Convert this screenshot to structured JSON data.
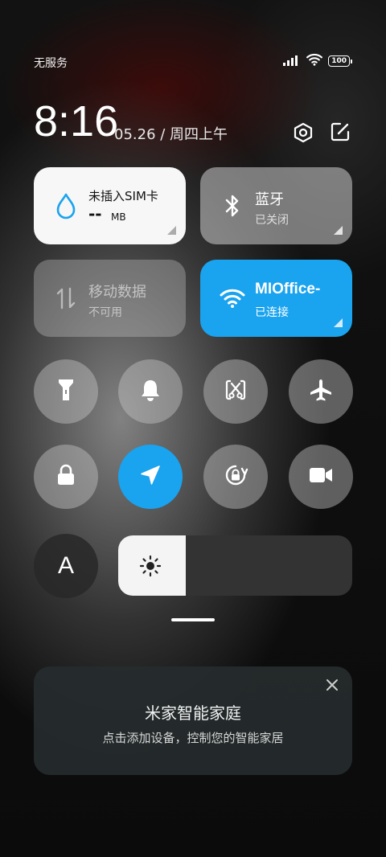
{
  "status_bar": {
    "carrier": "无服务",
    "battery": "100",
    "icons": [
      "signal-icon",
      "wifi-icon",
      "battery-icon"
    ]
  },
  "header": {
    "time": "8:16",
    "date": "05.26 / 周四上午",
    "icons": [
      "settings-icon",
      "edit-icon"
    ]
  },
  "tiles": {
    "sim": {
      "title": "未插入SIM卡",
      "value": "--",
      "unit": "MB",
      "icon": "water-drop-icon"
    },
    "bluetooth": {
      "title": "蓝牙",
      "status": "已关闭",
      "icon": "bluetooth-icon"
    },
    "mobile_data": {
      "title": "移动数据",
      "status": "不可用",
      "icon": "data-arrows-icon"
    },
    "wifi": {
      "title": "MIOffice-",
      "status": "已连接",
      "icon": "wifi-icon"
    }
  },
  "toggles": [
    {
      "name": "flashlight-icon",
      "active": false
    },
    {
      "name": "bell-icon",
      "active": false
    },
    {
      "name": "screenshot-icon",
      "active": false
    },
    {
      "name": "airplane-icon",
      "active": false
    },
    {
      "name": "lock-icon",
      "active": false
    },
    {
      "name": "location-icon",
      "active": true
    },
    {
      "name": "rotation-lock-icon",
      "active": false
    },
    {
      "name": "video-camera-icon",
      "active": false
    }
  ],
  "auto_brightness": {
    "label": "A"
  },
  "brightness": {
    "level": 0.29,
    "icon": "sun-icon"
  },
  "smart_home_card": {
    "title": "米家智能家庭",
    "subtitle": "点击添加设备，控制您的智能家居",
    "close_icon": "close-icon"
  },
  "colors": {
    "accent": "#1aa3ee",
    "tile_white": "#f7f7f7"
  }
}
